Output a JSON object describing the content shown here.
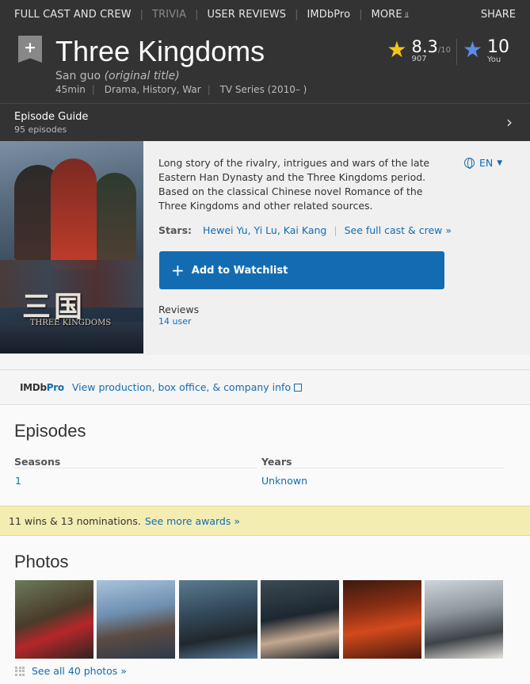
{
  "nav": {
    "items": [
      "FULL CAST AND CREW",
      "TRIVIA",
      "USER REVIEWS",
      "IMDbPro",
      "MORE"
    ],
    "share": "SHARE"
  },
  "title": {
    "main": "Three Kingdoms",
    "original": "San guo",
    "original_suffix": "(original title)",
    "runtime": "45min",
    "genres": "Drama, History, War",
    "type": "TV Series (2010– )",
    "rating": "8.3",
    "rating_outof": "/10",
    "rating_count": "907",
    "your_rating": "10",
    "your_label": "You"
  },
  "episode_guide": {
    "label": "Episode Guide",
    "count": "95 episodes"
  },
  "overview": {
    "plot": "Long story of the rivalry, intrigues and wars of the late Eastern Han Dynasty and the Three Kingdoms period. Based on the classical Chinese novel Romance of the Three Kingdoms and other related sources.",
    "language": "EN",
    "stars_label": "Stars:",
    "stars": "Hewei Yu, Yi Lu, Kai Kang",
    "stars_more": "See full cast & crew »",
    "watchlist": "Add to Watchlist",
    "reviews_label": "Reviews",
    "reviews_count": "14 user",
    "poster_title": "三国",
    "poster_subtitle": "THREE KINGDOMS"
  },
  "pro": {
    "logo_a": "IMDb",
    "logo_b": "Pro",
    "link": "View production, box office, & company info"
  },
  "episodes": {
    "title": "Episodes",
    "seasons_label": "Seasons",
    "seasons_value": "1",
    "years_label": "Years",
    "years_value": "Unknown"
  },
  "awards": {
    "text": "11 wins & 13 nominations.",
    "link": "See more awards »"
  },
  "photos": {
    "title": "Photos",
    "see_all": "See all 40 photos »"
  },
  "colors": {
    "brand_yellow": "#f5c518",
    "link_blue": "#136cb2",
    "header_bg": "#333333",
    "awards_bg": "#f4edb2"
  }
}
